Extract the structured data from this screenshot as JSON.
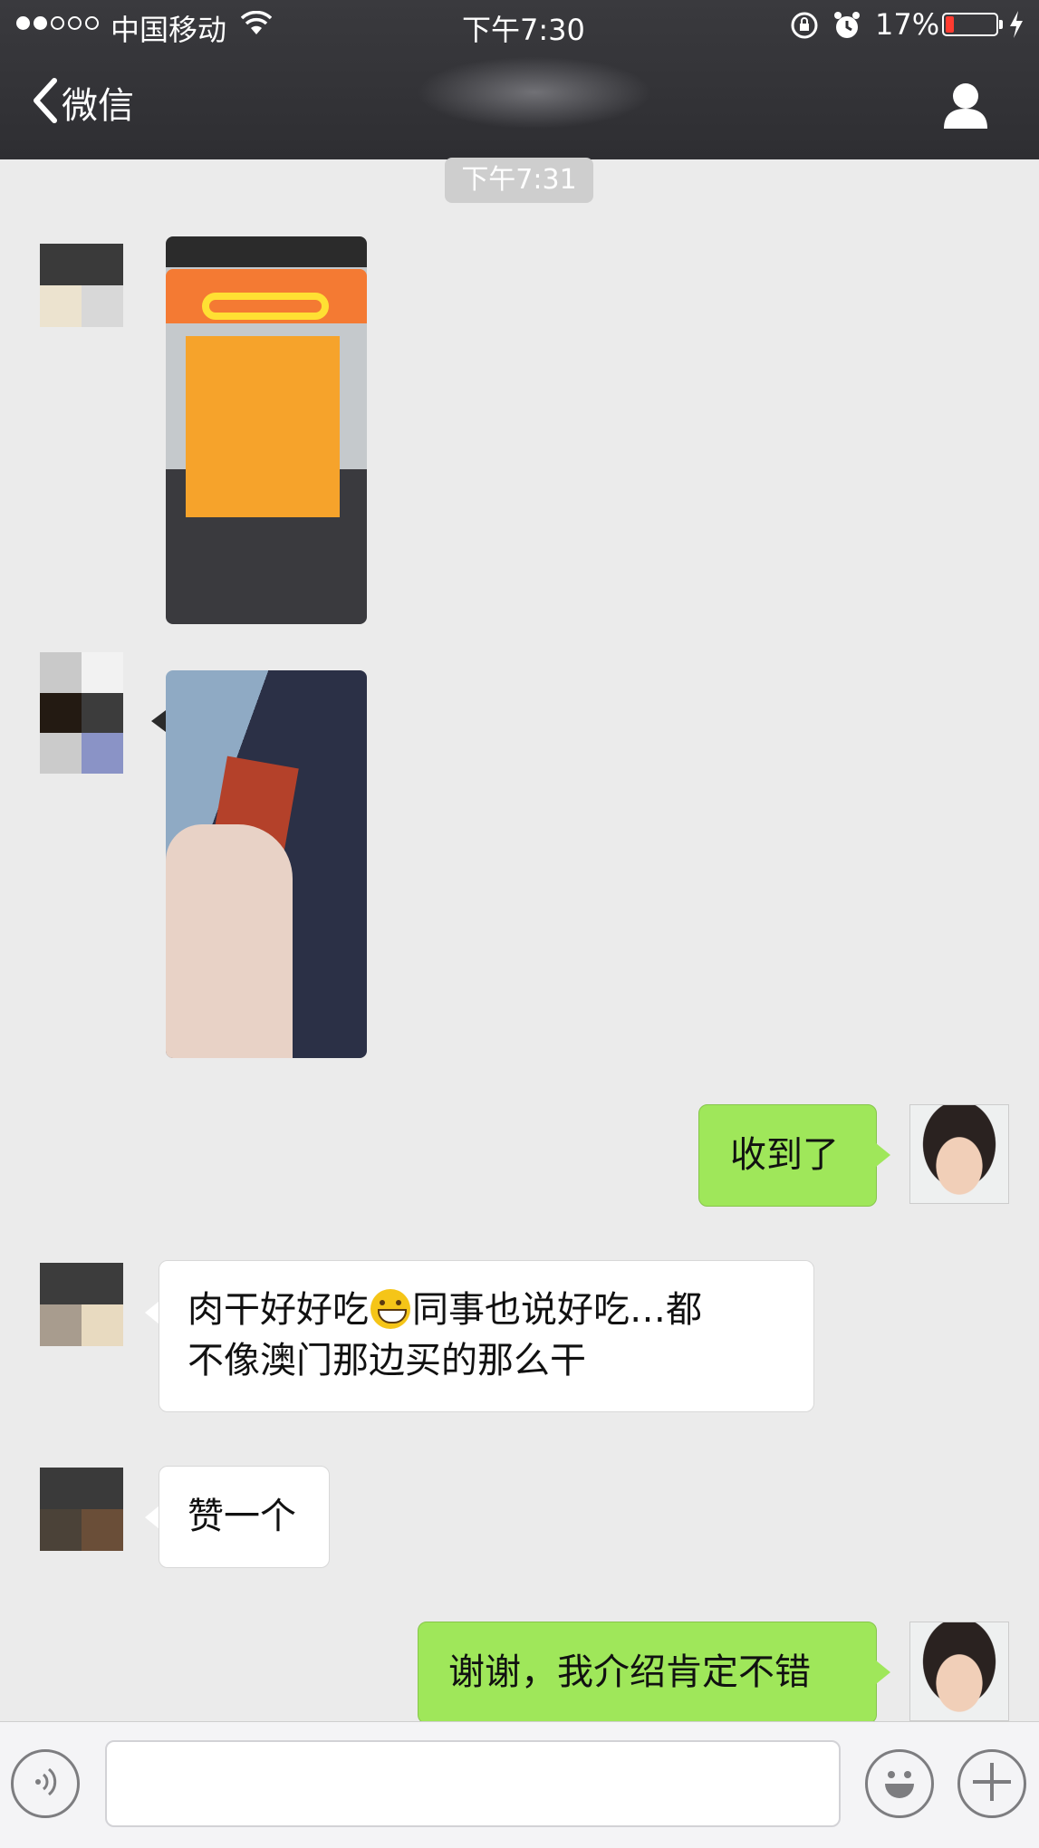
{
  "status_bar": {
    "carrier": "中国移动",
    "time": "下午7:30",
    "battery_percent": "17%",
    "battery_level": 0.17,
    "signal_bars_filled": 2,
    "signal_bars_total": 5,
    "icons": [
      "wifi-icon",
      "rotation-lock-icon",
      "alarm-icon",
      "battery-icon",
      "charging-bolt-icon"
    ]
  },
  "nav": {
    "back_label": "微信",
    "icons": [
      "back-chevron-icon",
      "contact-profile-icon"
    ]
  },
  "chat": {
    "timestamp": "下午7:31",
    "messages": [
      {
        "side": "in",
        "type": "image",
        "content": "photo of snack container"
      },
      {
        "side": "in",
        "type": "image",
        "content": "photo of jerky in hand"
      },
      {
        "side": "out",
        "type": "text",
        "text": "收到了"
      },
      {
        "side": "in",
        "type": "text",
        "text_before_emoji": "肉干好好吃",
        "text_after_emoji_line1": "同事也说好吃…都",
        "text_line2": "不像澳门那边买的那么干"
      },
      {
        "side": "in",
        "type": "text",
        "text": "赞一个"
      },
      {
        "side": "out",
        "type": "text",
        "text": "谢谢，我介绍肯定不错"
      }
    ]
  },
  "input_bar": {
    "value": "",
    "icons": [
      "voice-icon",
      "emoji-icon",
      "plus-icon"
    ]
  },
  "colors": {
    "nav_bg": "#2e2e32",
    "chat_bg": "#ebebeb",
    "outgoing_bubble": "#9fe75a",
    "incoming_bubble": "#ffffff",
    "battery_low": "#ff3b30"
  }
}
